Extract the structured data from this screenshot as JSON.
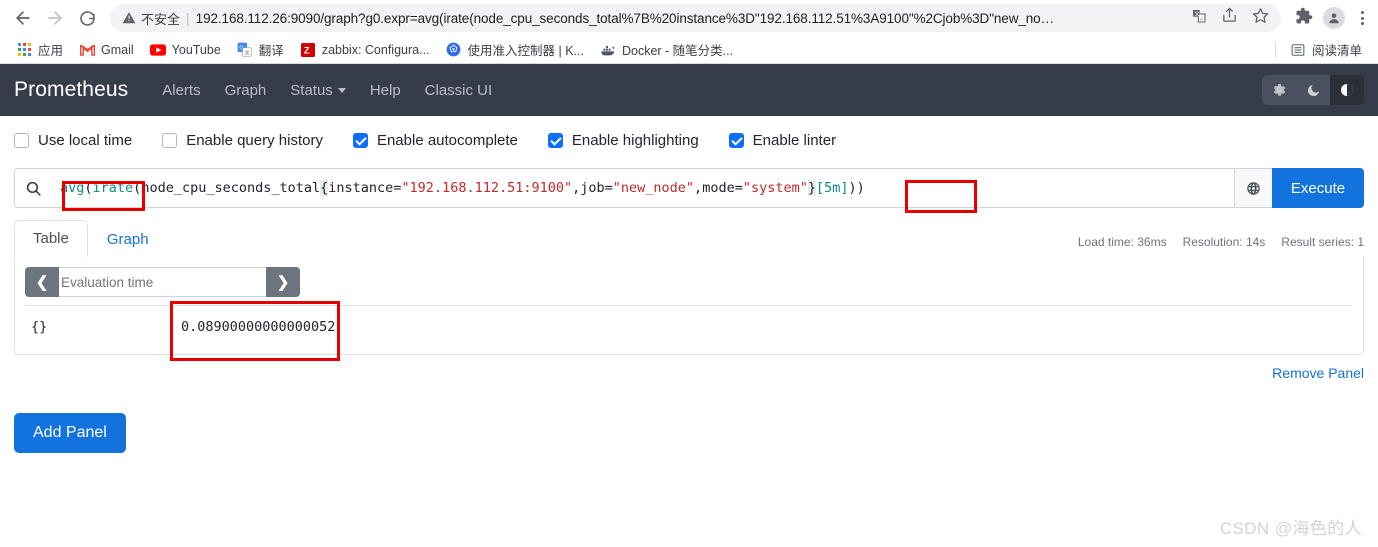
{
  "browser": {
    "nav": {
      "back": "back-arrow",
      "forward": "forward-arrow",
      "reload": "reload"
    },
    "omnibox": {
      "security_warning": "不安全",
      "url": "192.168.112.26:9090/graph?g0.expr=avg(irate(node_cpu_seconds_total%7B%20instance%3D\"192.168.112.51%3A9100\"%2Cjob%3D\"new_no…"
    },
    "bookmarks": [
      {
        "label": "应用",
        "icon": "apps-grid-icon"
      },
      {
        "label": "Gmail",
        "icon": "gmail-icon"
      },
      {
        "label": "YouTube",
        "icon": "youtube-icon"
      },
      {
        "label": "翻译",
        "icon": "google-translate-icon"
      },
      {
        "label": "zabbix: Configura...",
        "icon": "zabbix-icon"
      },
      {
        "label": "使用准入控制器 | K...",
        "icon": "kubernetes-icon"
      },
      {
        "label": "Docker - 随笔分类...",
        "icon": "docker-icon"
      }
    ],
    "reading_list": "阅读清单"
  },
  "prometheus": {
    "brand": "Prometheus",
    "nav_links": [
      {
        "label": "Alerts",
        "dropdown": false
      },
      {
        "label": "Graph",
        "dropdown": false
      },
      {
        "label": "Status",
        "dropdown": true
      },
      {
        "label": "Help",
        "dropdown": false
      },
      {
        "label": "Classic UI",
        "dropdown": false
      }
    ],
    "theme_buttons": [
      {
        "name": "light-theme",
        "icon": "gear-icon",
        "active": false
      },
      {
        "name": "dark-theme",
        "icon": "moon-icon",
        "active": false
      },
      {
        "name": "auto-theme",
        "icon": "half-circle-icon",
        "active": true
      }
    ]
  },
  "options": [
    {
      "label": "Use local time",
      "checked": false
    },
    {
      "label": "Enable query history",
      "checked": false
    },
    {
      "label": "Enable autocomplete",
      "checked": true
    },
    {
      "label": "Enable highlighting",
      "checked": true
    },
    {
      "label": "Enable linter",
      "checked": true
    }
  ],
  "query": {
    "full_text": "avg(irate(node_cpu_seconds_total{ instance=\"192.168.112.51:9100\",job=\"new_node\",mode=\"system\"}[5m]))",
    "tokens": {
      "fn_avg": "avg",
      "paren1": "(",
      "fn_irate": "irate",
      "paren2": "(",
      "metric": "node_cpu_seconds_total",
      "brace_open": "{",
      "label_instance": " instance=",
      "str_instance": "\"192.168.112.51:9100\"",
      "comma1": ",",
      "label_job": "job=",
      "str_job": "\"new_node\"",
      "comma2": ",",
      "label_mode": "mode=",
      "str_mode": "\"system\"",
      "brace_close": "}",
      "duration": "[5m]",
      "close_parens": "))"
    },
    "globe_icon": "globe-icon",
    "execute_label": "Execute",
    "search_icon": "search-icon"
  },
  "tabs": [
    {
      "label": "Table",
      "active": true
    },
    {
      "label": "Graph",
      "active": false
    }
  ],
  "stats": {
    "load_time": "Load time: 36ms",
    "resolution": "Resolution: 14s",
    "result_series": "Result series: 1"
  },
  "evaluation": {
    "prev_icon": "chevron-left-icon",
    "next_icon": "chevron-right-icon",
    "placeholder": "Evaluation time"
  },
  "result": {
    "rows": [
      {
        "metric": "{}",
        "value": "0.08900000000000052"
      }
    ]
  },
  "actions": {
    "remove_panel": "Remove Panel",
    "add_panel": "Add Panel"
  },
  "watermark": "CSDN @海色的人",
  "colors": {
    "accent_blue": "#1273de",
    "navbar_bg": "#373d48",
    "annotation_red": "#e80000",
    "syntax_function": "#0d8a8a",
    "syntax_string": "#c52828"
  }
}
